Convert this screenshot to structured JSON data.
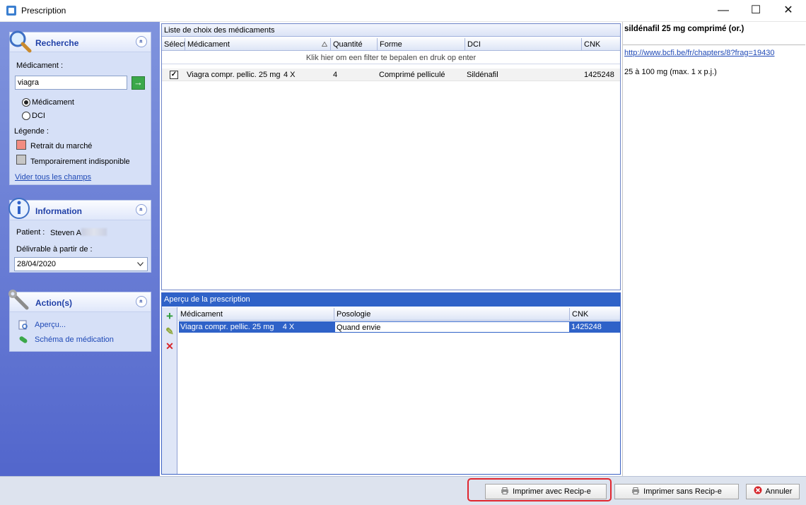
{
  "window": {
    "title": "Prescription",
    "minimize": "—",
    "maximize": "☐",
    "close": "✕"
  },
  "search": {
    "title": "Recherche",
    "collapse": "«",
    "medicament_label": "Médicament :",
    "query": "viagra",
    "go": "→",
    "radio_medicament": "Médicament",
    "radio_dci": "DCI",
    "selected_radio": "Médicament",
    "legend_label": "Légende :",
    "legend_withdrawn": "Retrait du marché",
    "legend_unavailable": "Temporairement indisponible",
    "clear_link": "Vider tous les champs",
    "colors": {
      "withdrawn": "#f28c82",
      "unavailable": "#c6c6c6"
    }
  },
  "information": {
    "title": "Information",
    "collapse": "«",
    "patient_label": "Patient :",
    "patient_name": "Steven A",
    "deliverable_label": "Délivrable à partir de :",
    "date": "28/04/2020"
  },
  "actions": {
    "title": "Action(s)",
    "collapse": "«",
    "preview": "Aperçu...",
    "medication_schema": "Schéma de médication"
  },
  "drug_list": {
    "title": "Liste de choix des médicaments",
    "columns": [
      "Sélect",
      "Médicament",
      "Quantité",
      "Forme",
      "DCI",
      "CNK"
    ],
    "filter_hint": "Klik hier om een filter te bepalen en druk op enter",
    "rows": [
      {
        "checked": true,
        "check_mark": "✓",
        "medicament": "Viagra compr. pellic. 25 mg",
        "pack": "4 X",
        "quantite": "4",
        "forme": "Comprimé pelliculé",
        "dci": "Sildénafil",
        "cnk": "1425248"
      }
    ]
  },
  "prescription_preview": {
    "title": "Aperçu de la prescription",
    "columns": [
      "Médicament",
      "Posologie",
      "CNK"
    ],
    "rows": [
      {
        "medicament": "Viagra compr. pellic. 25 mg",
        "pack": "4 X",
        "posologie": "Quand envie",
        "cnk": "1425248"
      }
    ],
    "tools": {
      "add": "+",
      "edit": "✎",
      "delete": "✕"
    }
  },
  "info_panel": {
    "title": "sildénafil 25 mg comprimé (or.)",
    "link": "http://www.bcfi.be/fr/chapters/8?frag=19430",
    "dosage": "25 à 100 mg (max. 1 x p.j.)"
  },
  "buttons": {
    "print_recipe": "Imprimer avec Recip-e",
    "print_no_recipe": "Imprimer sans Recip-e",
    "cancel": "Annuler"
  },
  "colors": {
    "accent": "#2f62c8",
    "highlight": "#e0262f"
  }
}
